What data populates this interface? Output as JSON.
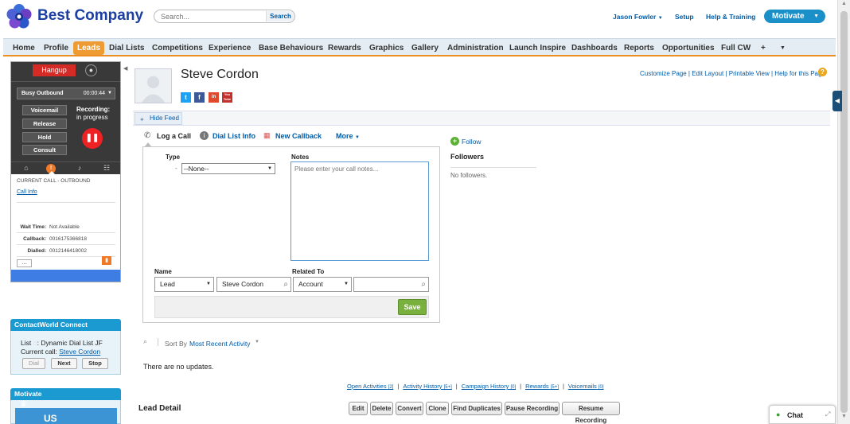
{
  "header": {
    "brand": "Best Company",
    "search_placeholder": "Search...",
    "search_button": "Search",
    "user_name": "Jason Fowler",
    "setup": "Setup",
    "help_training": "Help & Training",
    "app_switcher": "Motivate"
  },
  "tabs": [
    "Home",
    "Profile",
    "Leads",
    "Dial Lists",
    "Competitions",
    "Experience",
    "Base Behaviours",
    "Rewards",
    "Graphics",
    "Gallery",
    "Administration",
    "Launch Inspire",
    "Dashboards",
    "Reports",
    "Opportunities",
    "Full CW",
    "+"
  ],
  "active_tab": "Leads",
  "softphone": {
    "hangup": "Hangup",
    "status": "Busy Outbound",
    "timer": "00:00:44",
    "buttons": [
      "Voicemail",
      "Release",
      "Hold",
      "Consult"
    ],
    "recording_line1": "Recording:",
    "recording_line2": "in progress",
    "current_call": "CURRENT CALL - OUTBOUND",
    "call_info": "Call Info",
    "wait_time_label": "Wait Time:",
    "wait_time": "Not Available",
    "callback_label": "Callback:",
    "callback": "0016175366818",
    "dialled_label": "Dialled:",
    "dialled": "0012146418002",
    "more": "..."
  },
  "contactworld": {
    "title": "ContactWorld Connect",
    "list_label": "List",
    "list_value": ": Dynamic Dial List JF",
    "current_call_label": "Current call:",
    "current_call_name": "Steve Cordon",
    "dial": "Dial",
    "next": "Next",
    "stop": "Stop"
  },
  "motivate_panel": {
    "title": "Motivate",
    "badge": "US"
  },
  "record": {
    "name": "Steve Cordon",
    "top_links": "Customize Page | Edit Layout | Printable View | Help for this Page",
    "social": [
      "t",
      "f",
      "in",
      "You Tube"
    ]
  },
  "feed": {
    "hide_feed": "Hide Feed",
    "publisher_tabs": [
      "Log a Call",
      "Dial List Info",
      "New Callback",
      "More"
    ],
    "type_label": "Type",
    "type_value": "--None--",
    "notes_label": "Notes",
    "notes_placeholder": "Please enter your call notes...",
    "name_label": "Name",
    "name_type": "Lead",
    "name_value": "Steve Cordon",
    "related_label": "Related To",
    "related_type": "Account",
    "save": "Save",
    "follow": "Follow",
    "followers_title": "Followers",
    "no_followers": "No followers.",
    "sort_label": "Sort By",
    "sort_value": "Most Recent Activity",
    "no_updates": "There are no updates."
  },
  "related_lists": [
    {
      "label": "Open Activities",
      "count": "[2]"
    },
    {
      "label": "Activity History",
      "count": "[5+]"
    },
    {
      "label": "Campaign History",
      "count": "[0]"
    },
    {
      "label": "Rewards",
      "count": "[5+]"
    },
    {
      "label": "Voicemails",
      "count": "[0]"
    }
  ],
  "lead_detail": {
    "title": "Lead Detail",
    "buttons": [
      "Edit",
      "Delete",
      "Convert",
      "Clone",
      "Find Duplicates",
      "Pause Recording",
      "Resume Recording"
    ]
  },
  "chat": {
    "label": "Chat"
  },
  "colors": {
    "brand_blue": "#1c3fa2",
    "accent_orange": "#ee9b34",
    "hangup_red": "#d52b27",
    "save_green": "#7ab03e",
    "panel_blue": "#1a9ad0"
  }
}
